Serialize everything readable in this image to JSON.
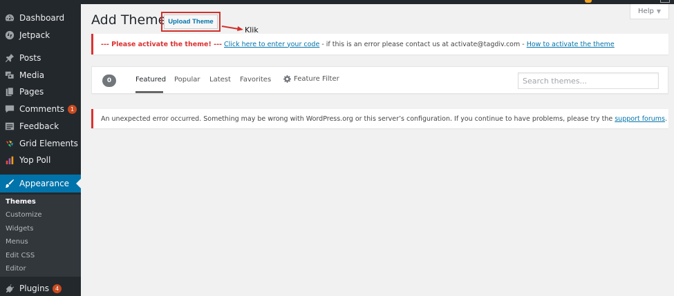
{
  "sidebar": {
    "items": [
      {
        "label": "Dashboard",
        "icon": "dashboard-icon"
      },
      {
        "label": "Jetpack",
        "icon": "jetpack-icon"
      },
      {
        "label": "Posts",
        "icon": "pin-icon"
      },
      {
        "label": "Media",
        "icon": "media-icon"
      },
      {
        "label": "Pages",
        "icon": "pages-icon"
      },
      {
        "label": "Comments",
        "icon": "comment-icon",
        "badge": "1"
      },
      {
        "label": "Feedback",
        "icon": "feedback-icon"
      },
      {
        "label": "Grid Elements",
        "icon": "grid-elements-icon"
      },
      {
        "label": "Yop Poll",
        "icon": "poll-icon"
      },
      {
        "label": "Appearance",
        "icon": "brush-icon"
      },
      {
        "label": "Plugins",
        "icon": "plugin-icon",
        "badge": "4"
      }
    ],
    "submenu": [
      "Themes",
      "Customize",
      "Widgets",
      "Menus",
      "Edit CSS",
      "Editor"
    ]
  },
  "header": {
    "title": "Add Themes",
    "upload_button": "Upload Theme",
    "annotation": "Klik",
    "help_label": "Help",
    "help_caret": "▼"
  },
  "notice_activate": {
    "warning": "--- Please activate the theme! ---",
    "link1": "Click here to enter your code",
    "middle": " - if this is an error please contact us at activate@tagdiv.com - ",
    "link2": "How to activate the theme"
  },
  "filters": {
    "count": "0",
    "tabs": [
      "Featured",
      "Popular",
      "Latest",
      "Favorites"
    ],
    "feature_filter": "Feature Filter",
    "search_placeholder": "Search themes..."
  },
  "notice_error": {
    "text": "An unexpected error occurred. Something may be wrong with WordPress.org or this server’s configuration. If you continue to have problems, please try the ",
    "link": "support forums",
    "end": "."
  },
  "colors": {
    "sidebar_bg": "#23282d",
    "active_menu": "#0073aa",
    "error_border": "#dc3232",
    "highlight_box": "#d0302b",
    "link": "#0073aa",
    "badge": "#ca4a1f"
  }
}
